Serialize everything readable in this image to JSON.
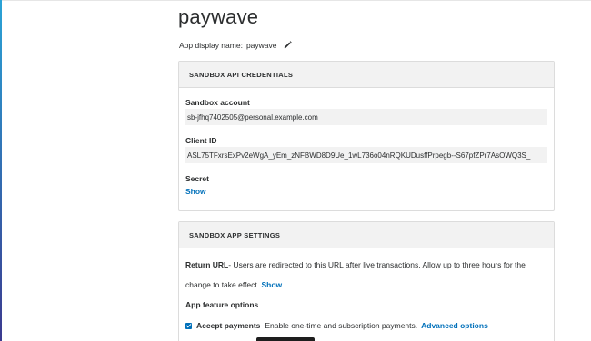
{
  "app": {
    "title": "paywave",
    "display_name_label": "App display name:",
    "display_name_value": "paywave"
  },
  "credentials": {
    "header": "SANDBOX API CREDENTIALS",
    "sandbox_account_label": "Sandbox account",
    "sandbox_account_value": "sb-jfhq7402505@personal.example.com",
    "client_id_label": "Client ID",
    "client_id_value": "ASL75TFxrsExPv2eWgA_yEm_zNFBWD8D9Ue_1wL736o04nRQKUDusffPrpegb--S67pfZPr7AsOWQ3S_",
    "secret_label": "Secret",
    "secret_show": "Show"
  },
  "settings": {
    "header": "SANDBOX APP SETTINGS",
    "return_url_label": "Return URL",
    "return_url_desc": "- Users are redirected to this URL after live transactions. Allow up to three hours for the change to take effect.",
    "return_url_show": "Show",
    "feature_options_label": "App feature options",
    "accept_payments_label": "Accept payments",
    "accept_payments_desc": "Enable one-time and subscription payments.",
    "advanced_options_link": "Advanced options",
    "accept_payments_checked": true
  },
  "colors": {
    "link": "#0070ba",
    "header_bg": "#f2f2f2",
    "text": "#2c2e2f"
  },
  "icons": {
    "edit": "pencil-icon"
  }
}
